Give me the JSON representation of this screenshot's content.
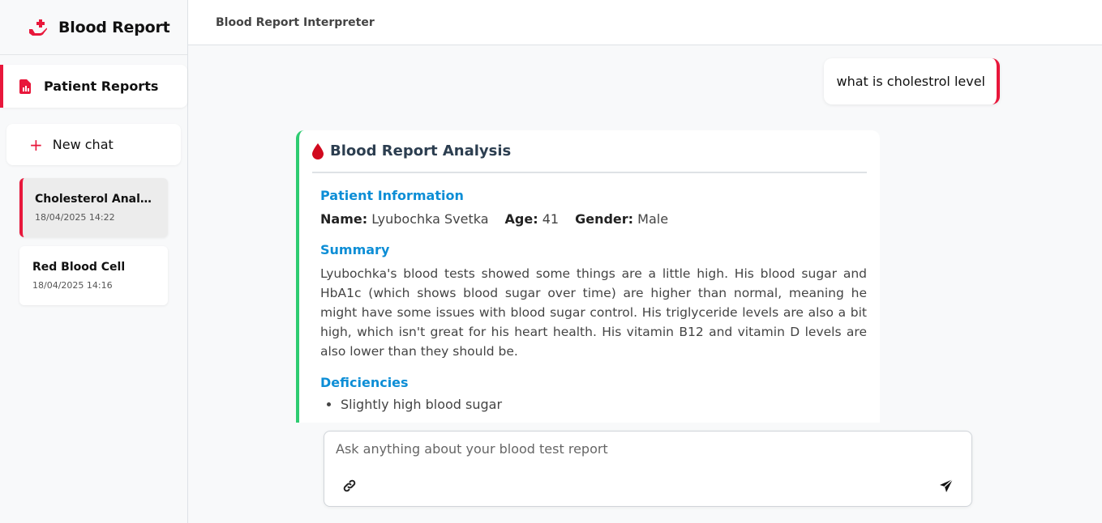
{
  "brand": {
    "title": "Blood Report",
    "icon": "hand-holding-medical-icon",
    "accent": "#e8173b"
  },
  "sidebar": {
    "nav_reports": {
      "label": "Patient Reports",
      "icon": "file-medical-icon"
    },
    "new_chat": {
      "label": "New chat",
      "icon": "plus-icon"
    },
    "chats": [
      {
        "title": "Cholesterol Analysis",
        "date": "18/04/2025 14:22",
        "active": true
      },
      {
        "title": "Red Blood Cell",
        "date": "18/04/2025 14:16",
        "active": false
      }
    ]
  },
  "header": {
    "title": "Blood Report Interpreter"
  },
  "conversation": {
    "user_message": "what is cholestrol level",
    "analysis": {
      "title": "Blood Report Analysis",
      "icon": "blood-drop-icon",
      "patient_info_title": "Patient Information",
      "patient": {
        "name_label": "Name:",
        "name": "Lyubochka Svetka",
        "age_label": "Age:",
        "age": "41",
        "gender_label": "Gender:",
        "gender": "Male"
      },
      "summary_title": "Summary",
      "summary": "Lyubochka's blood tests showed some things are a little high. His blood sugar and HbA1c (which shows blood sugar over time) are higher than normal, meaning he might have some issues with blood sugar control. His triglyceride levels are also a bit high, which isn't great for his heart health. His vitamin B12 and vitamin D levels are also lower than they should be.",
      "deficiencies_title": "Deficiencies",
      "deficiencies": [
        "Slightly high blood sugar"
      ]
    }
  },
  "input": {
    "placeholder": "Ask anything about your blood test report",
    "attach_icon": "link-icon",
    "send_icon": "send-icon"
  },
  "colors": {
    "accent": "#e8173b",
    "success": "#2ecc71",
    "section": "#0d8ed6"
  }
}
